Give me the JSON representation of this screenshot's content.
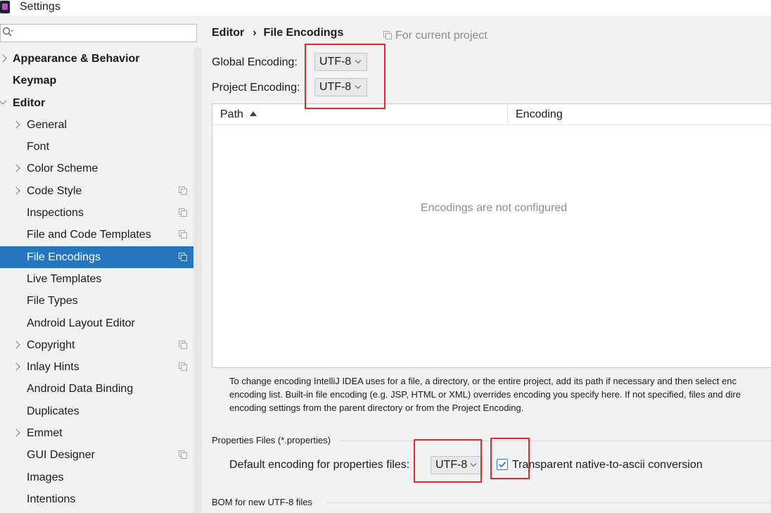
{
  "window": {
    "title": "Settings"
  },
  "search": {
    "placeholder": ""
  },
  "sidebar": {
    "items": [
      {
        "label": "Appearance & Behavior",
        "level": 0,
        "bold": true,
        "expander": "right",
        "project": false,
        "selected": false
      },
      {
        "label": "Keymap",
        "level": 0,
        "bold": true,
        "expander": "none",
        "project": false,
        "selected": false
      },
      {
        "label": "Editor",
        "level": 0,
        "bold": true,
        "expander": "down",
        "project": false,
        "selected": false
      },
      {
        "label": "General",
        "level": 1,
        "bold": false,
        "expander": "right",
        "project": false,
        "selected": false
      },
      {
        "label": "Font",
        "level": 1,
        "bold": false,
        "expander": "none",
        "project": false,
        "selected": false
      },
      {
        "label": "Color Scheme",
        "level": 1,
        "bold": false,
        "expander": "right",
        "project": false,
        "selected": false
      },
      {
        "label": "Code Style",
        "level": 1,
        "bold": false,
        "expander": "right",
        "project": true,
        "selected": false
      },
      {
        "label": "Inspections",
        "level": 1,
        "bold": false,
        "expander": "none",
        "project": true,
        "selected": false
      },
      {
        "label": "File and Code Templates",
        "level": 1,
        "bold": false,
        "expander": "none",
        "project": true,
        "selected": false
      },
      {
        "label": "File Encodings",
        "level": 1,
        "bold": false,
        "expander": "none",
        "project": true,
        "selected": true
      },
      {
        "label": "Live Templates",
        "level": 1,
        "bold": false,
        "expander": "none",
        "project": false,
        "selected": false
      },
      {
        "label": "File Types",
        "level": 1,
        "bold": false,
        "expander": "none",
        "project": false,
        "selected": false
      },
      {
        "label": "Android Layout Editor",
        "level": 1,
        "bold": false,
        "expander": "none",
        "project": false,
        "selected": false
      },
      {
        "label": "Copyright",
        "level": 1,
        "bold": false,
        "expander": "right",
        "project": true,
        "selected": false
      },
      {
        "label": "Inlay Hints",
        "level": 1,
        "bold": false,
        "expander": "right",
        "project": true,
        "selected": false
      },
      {
        "label": "Android Data Binding",
        "level": 1,
        "bold": false,
        "expander": "none",
        "project": false,
        "selected": false
      },
      {
        "label": "Duplicates",
        "level": 1,
        "bold": false,
        "expander": "none",
        "project": false,
        "selected": false
      },
      {
        "label": "Emmet",
        "level": 1,
        "bold": false,
        "expander": "right",
        "project": false,
        "selected": false
      },
      {
        "label": "GUI Designer",
        "level": 1,
        "bold": false,
        "expander": "none",
        "project": true,
        "selected": false
      },
      {
        "label": "Images",
        "level": 1,
        "bold": false,
        "expander": "none",
        "project": false,
        "selected": false
      },
      {
        "label": "Intentions",
        "level": 1,
        "bold": false,
        "expander": "none",
        "project": false,
        "selected": false
      }
    ]
  },
  "breadcrumb": {
    "parent": "Editor",
    "separator": "›",
    "current": "File Encodings"
  },
  "scope_note": "For current project",
  "global_encoding": {
    "label": "Global Encoding:",
    "value": "UTF-8"
  },
  "project_encoding": {
    "label": "Project Encoding:",
    "value": "UTF-8"
  },
  "table": {
    "columns": [
      "Path",
      "Encoding"
    ],
    "empty_text": "Encodings are not configured"
  },
  "help_text": [
    "To change encoding IntelliJ IDEA uses for a file, a directory, or the entire project, add its path if necessary and then select enc",
    "encoding list. Built-in file encoding (e.g. JSP, HTML or XML) overrides encoding you specify here. If not specified, files and dire",
    "encoding settings from the parent directory or from the Project Encoding."
  ],
  "properties_section": {
    "title": "Properties Files (*.properties)",
    "default_label": "Default encoding for properties files:",
    "default_value": "UTF-8",
    "native_checkbox_label": "Transparent native-to-ascii conversion",
    "native_checked": true
  },
  "bom_section": {
    "title": "BOM for new UTF-8 files"
  },
  "colors": {
    "selection": "#2675bf",
    "highlight_box": "#e02b2b",
    "checkbox_accent": "#2c7bd3"
  }
}
